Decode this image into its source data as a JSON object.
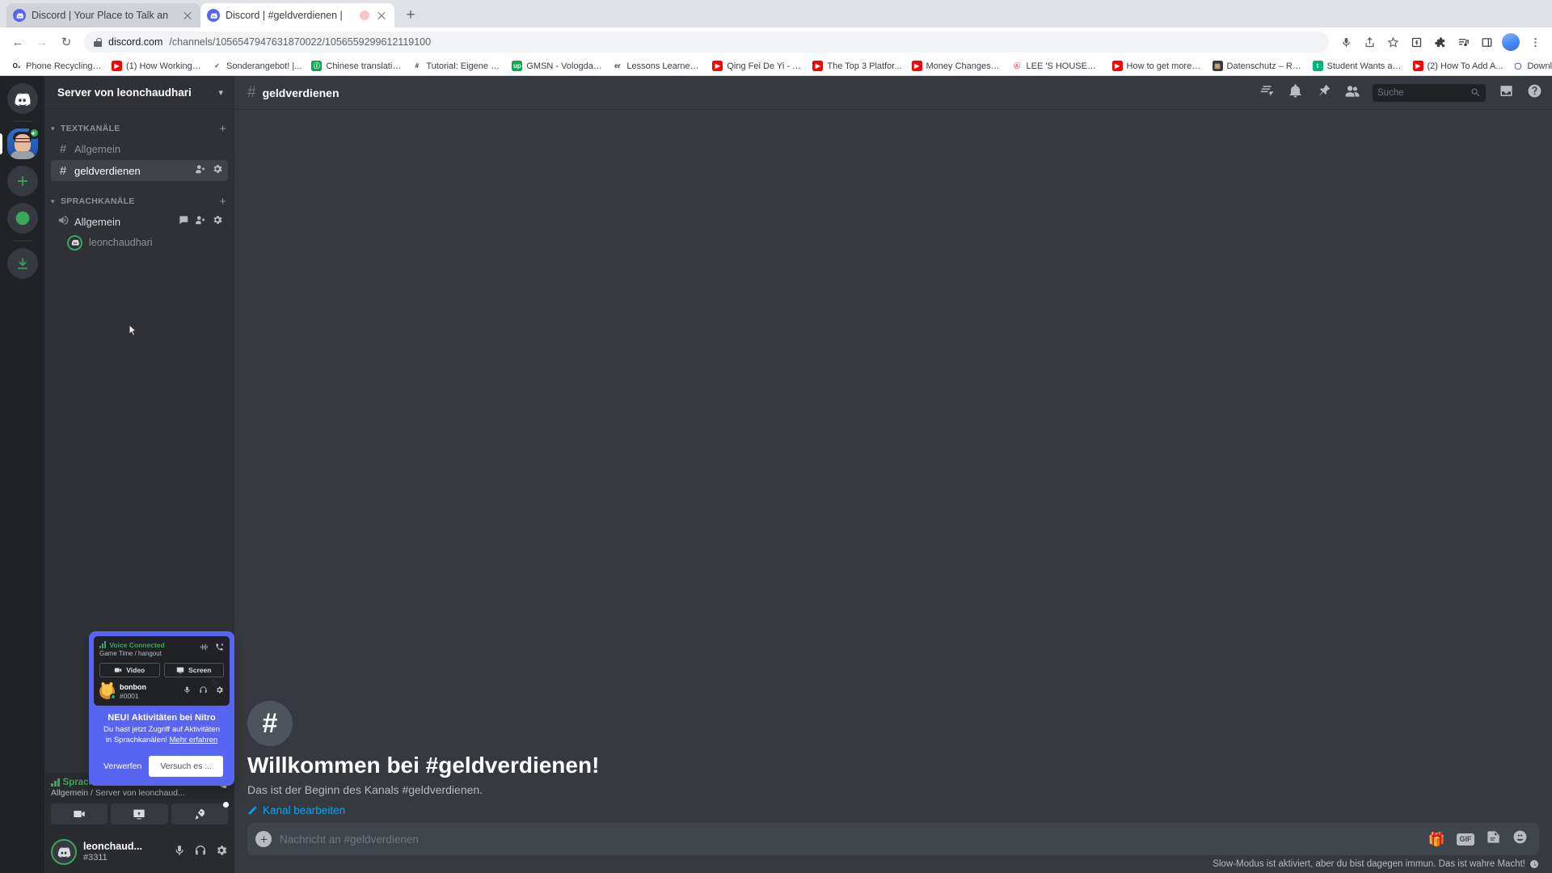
{
  "browser": {
    "tabs": [
      {
        "title": "Discord | Your Place to Talk an",
        "active": false,
        "recording": false
      },
      {
        "title": "Discord | #geldverdienen |",
        "active": true,
        "recording": true
      }
    ],
    "newtab_label": "+",
    "nav": {
      "back": "←",
      "forward": "→",
      "reload": "↻"
    },
    "url": {
      "host": "discord.com",
      "path": "/channels/1056547947631870022/1056559299612119100"
    },
    "bookmarks": [
      {
        "label": "Phone Recycling,...",
        "icon": "o2-icon",
        "color": "#ffffff",
        "text": "O₂",
        "textcolor": "#1a1a1a"
      },
      {
        "label": "(1) How Working a...",
        "icon": "youtube-icon",
        "color": "#ff0000",
        "text": "▶",
        "textcolor": "#ffffff"
      },
      {
        "label": "Sonderangebot! |...",
        "icon": "check-circle-icon",
        "color": "#ffffff",
        "text": "✓",
        "textcolor": "#444444"
      },
      {
        "label": "Chinese translatio...",
        "icon": "green-circle-icon",
        "color": "#0aa84f",
        "text": "Ⓘ",
        "textcolor": "#ffffff"
      },
      {
        "label": "Tutorial: Eigene Fa...",
        "icon": "hash-icon",
        "color": "#ffffff",
        "text": "#",
        "textcolor": "#2b2b2b"
      },
      {
        "label": "GMSN - Vologda,...",
        "icon": "up-circle-icon",
        "color": "#0aa84f",
        "text": "up",
        "textcolor": "#ffffff"
      },
      {
        "label": "Lessons Learned f...",
        "icon": "er-text-icon",
        "color": "#ffffff",
        "text": "er",
        "textcolor": "#3c4043"
      },
      {
        "label": "Qing Fei De Yi - Y...",
        "icon": "youtube-icon",
        "color": "#ff0000",
        "text": "▶",
        "textcolor": "#ffffff"
      },
      {
        "label": "The Top 3 Platfor...",
        "icon": "youtube-icon",
        "color": "#ff0000",
        "text": "▶",
        "textcolor": "#ffffff"
      },
      {
        "label": "Money Changes E...",
        "icon": "youtube-icon",
        "color": "#ff0000",
        "text": "▶",
        "textcolor": "#ffffff"
      },
      {
        "label": "LEE 'S HOUSE—...",
        "icon": "airbnb-icon",
        "color": "#ffffff",
        "text": "Ⓐ",
        "textcolor": "#ff5a5f"
      },
      {
        "label": "How to get more v...",
        "icon": "youtube-icon",
        "color": "#ff0000",
        "text": "▶",
        "textcolor": "#ffffff"
      },
      {
        "label": "Datenschutz – Re...",
        "icon": "photo-icon",
        "color": "#3a3a3a",
        "text": "▦",
        "textcolor": "#c9a98a"
      },
      {
        "label": "Student Wants an...",
        "icon": "teal-circle-icon",
        "color": "#00b37e",
        "text": "t",
        "textcolor": "#ffffff"
      },
      {
        "label": "(2) How To Add A...",
        "icon": "youtube-icon",
        "color": "#ff0000",
        "text": "▶",
        "textcolor": "#ffffff"
      },
      {
        "label": "Download - Cooki...",
        "icon": "purple-circle-icon",
        "color": "#ffffff",
        "text": "◯",
        "textcolor": "#6a2fd0"
      }
    ],
    "bookmark_overflow": "»",
    "toolbar_icons": [
      "mic-icon",
      "share-icon",
      "bookmark-star-icon",
      "facebook-icon",
      "extensions-icon",
      "playlist-icon",
      "sidepanel-icon",
      "profile-avatar",
      "chrome-menu-icon"
    ]
  },
  "guild_rail": {
    "home_label": "discord-home",
    "server_badge": "voice-connected",
    "add_server_label": "+",
    "explore_label": "compass",
    "download_label": "download"
  },
  "sidebar": {
    "server_name": "Server von leonchaudhari",
    "categories": [
      {
        "name": "TEXTKANÄLE",
        "type": "text",
        "channels": [
          {
            "name": "Allgemein",
            "active": false
          },
          {
            "name": "geldverdienen",
            "active": true
          }
        ]
      },
      {
        "name": "SPRACHKANÄLE",
        "type": "voice",
        "channels": [
          {
            "name": "Allgemein",
            "active": false
          }
        ],
        "voice_members": [
          {
            "name": "leonchaudhari"
          }
        ]
      }
    ]
  },
  "nitro_popout": {
    "preview": {
      "status": "Voice Connected",
      "subtitle": "Game Time / hangout",
      "video_label": "Video",
      "screen_label": "Screen",
      "user_name": "bonbon",
      "user_tag": "#0001"
    },
    "title": "NEU! Aktivitäten bei Nitro",
    "description": "Du hast jetzt Zugriff auf Aktivitäten in Sprachkanälen!",
    "link_text": "Mehr erfahren",
    "dismiss_label": "Verwerfen",
    "try_label": "Versuch es ..."
  },
  "voice_bar": {
    "status": "Sprachchat verbunden",
    "subtitle": "Allgemein / Server von leonchaud...",
    "buttons": [
      "video-camera-icon",
      "screen-share-icon",
      "activities-rocket-icon"
    ]
  },
  "user_panel": {
    "name": "leonchaud...",
    "tag": "#3311",
    "controls": [
      "microphone-icon",
      "headphones-icon",
      "settings-gear-icon"
    ]
  },
  "channel_header": {
    "hash": "#",
    "title": "geldverdienen",
    "icons": [
      "threads-icon",
      "notification-bell-icon",
      "pinned-messages-icon",
      "member-list-icon"
    ],
    "search_placeholder": "Suche",
    "right_icons": [
      "inbox-icon",
      "help-icon"
    ]
  },
  "welcome": {
    "hash": "#",
    "title": "Willkommen bei #geldverdienen!",
    "subtitle": "Das ist der Beginn des Kanals #geldverdienen.",
    "edit_label": "Kanal bearbeiten"
  },
  "composer": {
    "placeholder": "Nachricht an #geldverdienen",
    "gif_label": "GIF",
    "icons": [
      "gift-icon",
      "gif-icon",
      "sticker-icon",
      "emoji-icon"
    ]
  },
  "slowmode": {
    "text": "Slow-Modus ist aktiviert, aber du bist dagegen immun. Das ist wahre Macht!",
    "icon": "clock-icon"
  },
  "colors": {
    "brand": "#5865f2",
    "online": "#3ba55d",
    "link": "#00a8fc",
    "sidebar_bg": "#2f3136",
    "chat_bg": "#36393f",
    "rail_bg": "#202225"
  }
}
